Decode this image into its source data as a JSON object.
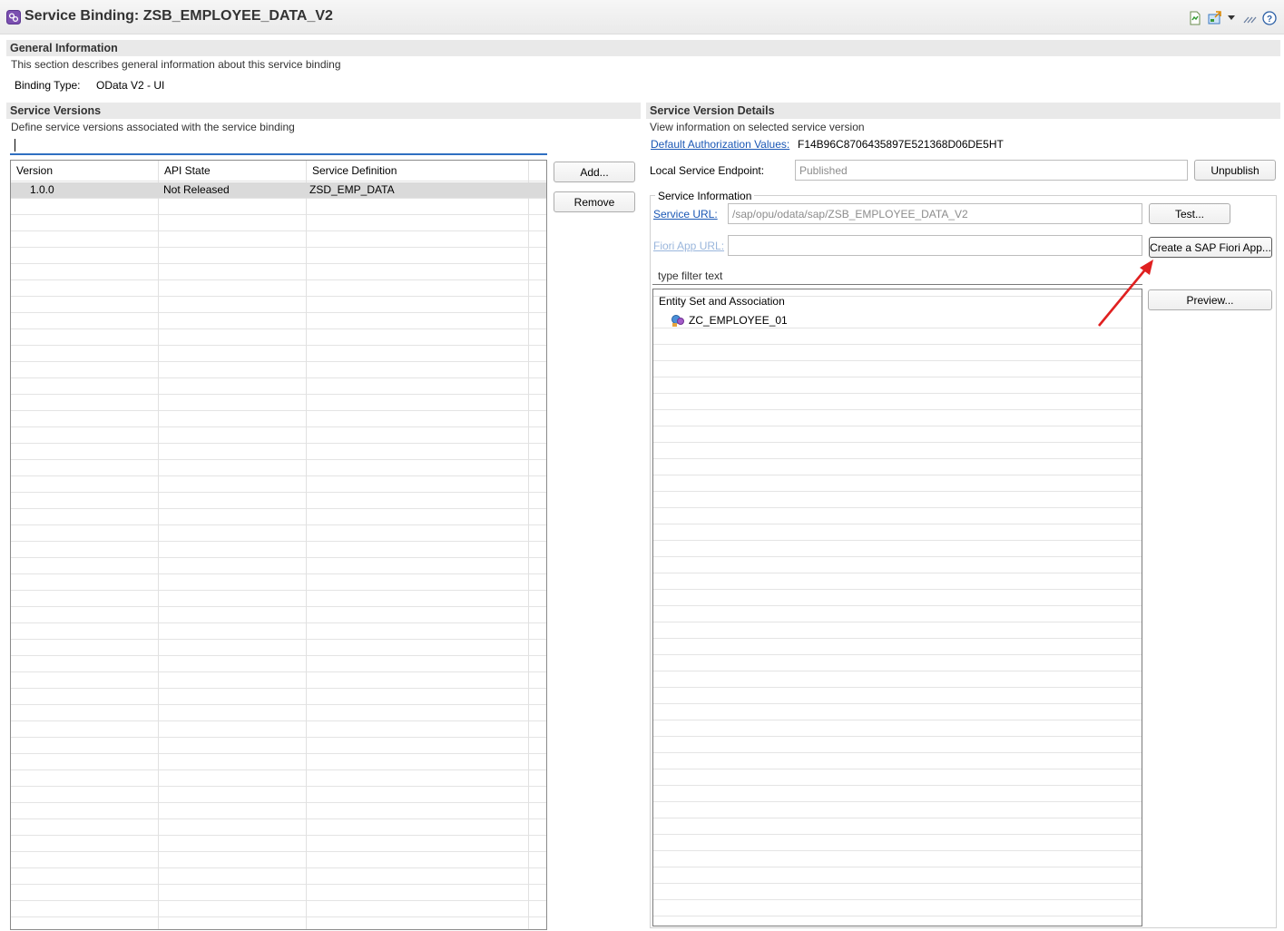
{
  "window": {
    "title": "Service Binding: ZSB_EMPLOYEE_DATA_V2",
    "title_icon": "service-binding-icon",
    "toolbar_icons": [
      "green-page-icon",
      "publish-icon",
      "dropdown-arrow-icon",
      "wand-icon",
      "help-icon"
    ]
  },
  "general": {
    "heading": "General Information",
    "description": "This section describes general information about this service binding",
    "binding_type_label": "Binding Type:",
    "binding_type_value": "OData V2 - UI"
  },
  "versions": {
    "heading": "Service Versions",
    "description": "Define service versions associated with the service binding",
    "search_value": "",
    "columns": [
      "Version",
      "API State",
      "Service Definition"
    ],
    "rows": [
      {
        "version": "1.0.0",
        "api_state": "Not Released",
        "service_definition": "ZSD_EMP_DATA"
      }
    ],
    "add_label": "Add...",
    "remove_label": "Remove"
  },
  "details": {
    "heading": "Service Version Details",
    "description": "View information on selected service version",
    "auth_link": "Default Authorization Values:",
    "auth_value": "F14B96C8706435897E521368D06DE5HT",
    "endpoint_label": "Local Service Endpoint:",
    "endpoint_value": "Published",
    "unpublish_label": "Unpublish",
    "service_info_title": "Service Information",
    "service_url_label": "Service URL:",
    "service_url_value": "/sap/opu/odata/sap/ZSB_EMPLOYEE_DATA_V2",
    "test_label": "Test...",
    "fiori_url_label": "Fiori App URL:",
    "fiori_url_value": "",
    "create_fiori_label": "Create a SAP Fiori App...",
    "filter_placeholder": "type filter text",
    "tree_header": "Entity Set and Association",
    "tree_items": [
      "ZC_EMPLOYEE_01"
    ],
    "preview_label": "Preview..."
  },
  "annotation": {
    "arrow_color": "#e02020"
  }
}
